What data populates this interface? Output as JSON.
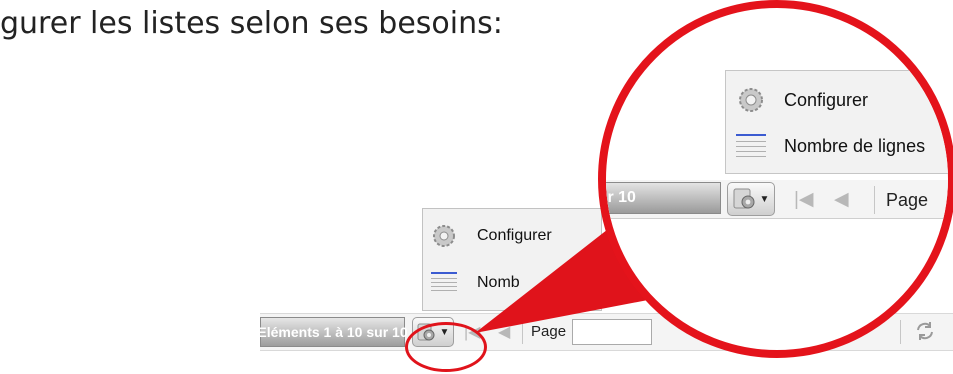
{
  "caption": "gurer les listes selon ses besoins:",
  "pager": {
    "status": "Eléments 1 à 10 sur 10",
    "page_label": "Page",
    "first_icon": "first-page-icon",
    "prev_icon": "previous-page-icon",
    "refresh_icon": "refresh-icon"
  },
  "menu": {
    "configure": "Configurer",
    "rows_short": "Nomb"
  },
  "zoom": {
    "status_fragment": "ir 10",
    "configure": "Configurer",
    "rows": "Nombre de lignes",
    "page_label": "Page"
  },
  "colors": {
    "highlight": "#e0131b",
    "toolbar": "#f4f4f4",
    "status_gradient_top": "#e6e6e6",
    "status_gradient_bottom": "#9c9c9c"
  }
}
